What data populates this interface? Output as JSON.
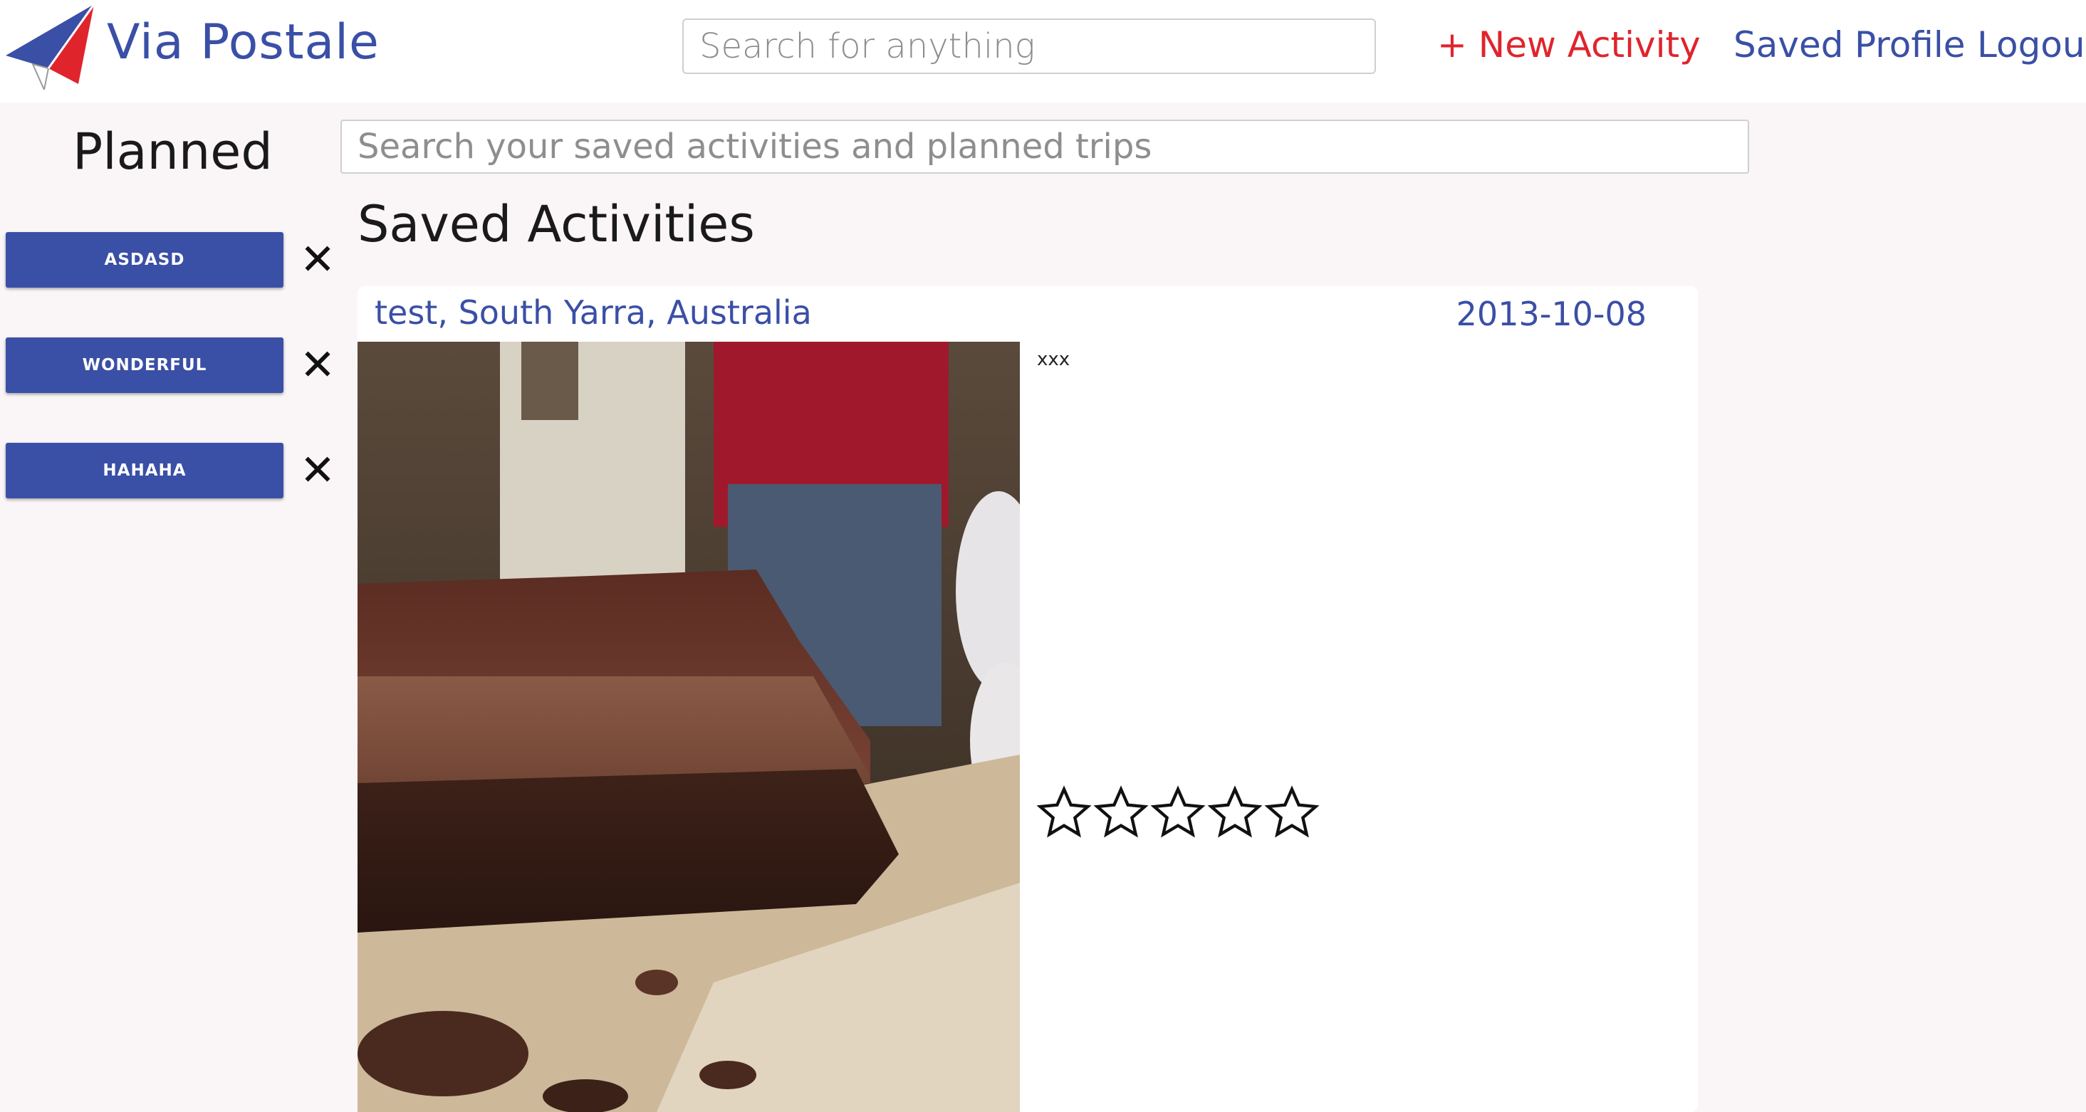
{
  "brand": {
    "name": "Via Postale",
    "logo_icon": "paper-plane-logo-icon"
  },
  "header": {
    "search_placeholder": "Search for anything",
    "new_activity_label": "+ New Activity",
    "nav": {
      "saved": "Saved",
      "profile": "Profile",
      "logout": "Logout"
    }
  },
  "planned": {
    "heading": "Planned",
    "trips": [
      {
        "label": "ASDASD"
      },
      {
        "label": "WONDERFUL"
      },
      {
        "label": "HAHAHA"
      }
    ],
    "remove_glyph": "✕"
  },
  "saved": {
    "search_placeholder": "Search your saved activities and planned trips",
    "heading": "Saved Activities",
    "activities": [
      {
        "title": "test, South Yarra, Australia",
        "date": "2013-10-08",
        "description": "xxx",
        "rating": 0,
        "max_rating": 5
      }
    ]
  },
  "colors": {
    "brand_blue": "#3a4fa6",
    "accent_red": "#e0242c",
    "page_bg": "#faf6f7"
  }
}
